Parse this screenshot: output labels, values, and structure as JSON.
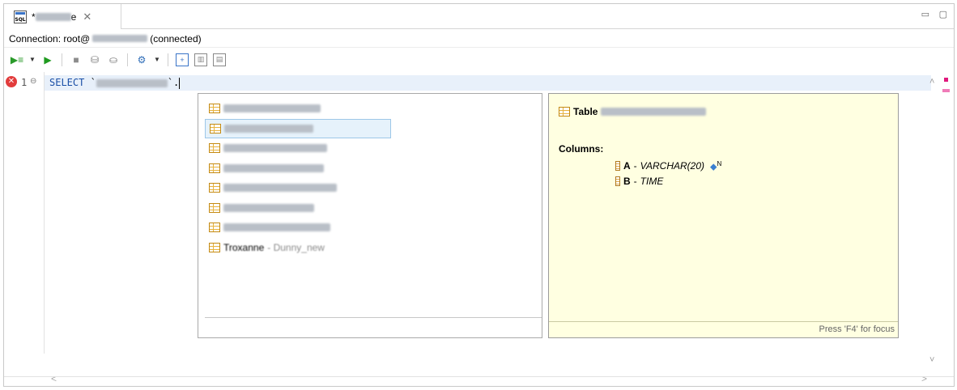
{
  "tab": {
    "title": "*",
    "close_icon": "close-icon"
  },
  "window": {
    "minimize_icon": "minimize-icon",
    "maximize_icon": "maximize-icon"
  },
  "connection": {
    "label": "Connection: root@",
    "status": "(connected)"
  },
  "toolbar": {
    "items": [
      "execute-script-icon",
      "dropdown-icon",
      "run-icon",
      "stop-icon",
      "explain-icon",
      "export-icon",
      "connection-icon",
      "dropdown-icon",
      "results-panel-icon",
      "grid-icon",
      "text-icon"
    ]
  },
  "editor": {
    "line_number": "1",
    "keyword": "SELECT",
    "code_rest": " `",
    "code_tail": "`."
  },
  "completion": {
    "items": [
      {
        "name": "Bmanne",
        "tail": "- Dunny_new"
      },
      {
        "name": "Bmanne_J",
        "tail": "- Dunny_new"
      },
      {
        "name": "Bmanne_Lurgy",
        "tail": "- Dunny_new"
      },
      {
        "name": "Dodeled",
        "tail": "- Dunny_new"
      },
      {
        "name": "Mmanne_Bunny",
        "tail": "- Dunny_new"
      },
      {
        "name": "Fmanne",
        "tail": "- Dunny_new"
      },
      {
        "name": "Fmanne_Lurgy",
        "tail": "- Dunny_new"
      },
      {
        "name": "Troxanne",
        "tail": "- Dunny_new"
      }
    ]
  },
  "info": {
    "title_prefix": "Table",
    "columns_label": "Columns:",
    "columns": [
      {
        "name": "A",
        "sep": " - ",
        "type": "VARCHAR(20)",
        "flag": "N"
      },
      {
        "name": "B",
        "sep": " - ",
        "type": "TIME",
        "flag": ""
      }
    ],
    "footer": "Press 'F4' for focus"
  },
  "colors": {
    "current_line": "#e8f0fa",
    "info_bg": "#ffffe1",
    "keyword": "#1a4fa6",
    "error": "#e23c3c"
  }
}
